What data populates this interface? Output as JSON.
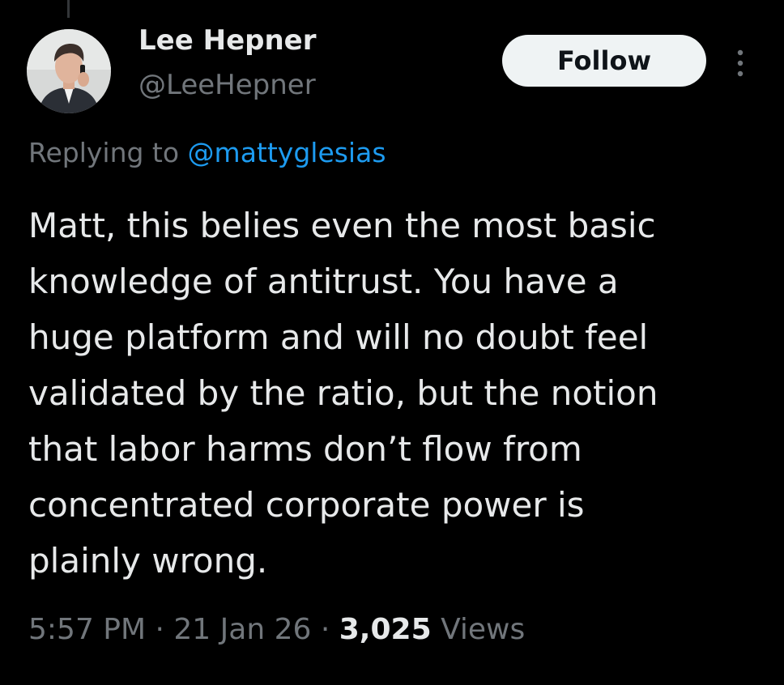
{
  "author": {
    "display_name": "Lee Hepner",
    "handle": "@LeeHepner"
  },
  "actions": {
    "follow_label": "Follow"
  },
  "reply_context": {
    "prefix": "Replying to ",
    "mention": "@mattyglesias"
  },
  "tweet": {
    "lines": [
      "Matt, this belies even the most basic",
      "knowledge of antitrust. You have a",
      "huge platform and will no doubt feel",
      "validated by the ratio, but the notion",
      "that labor harms don’t flow from",
      "concentrated corporate power is",
      "plainly wrong."
    ]
  },
  "meta": {
    "time": "5:57 PM",
    "sep1": " · ",
    "date": "21 Jan 26",
    "sep2": " · ",
    "views_count": "3,025",
    "views_label": " Views"
  },
  "icons": {
    "more": "more-vertical-icon",
    "avatar": "avatar-photo"
  },
  "colors": {
    "background": "#000000",
    "text_primary": "#e7e9ea",
    "text_secondary": "#71767b",
    "link": "#1d9bf0",
    "follow_bg": "#eff3f4",
    "follow_text": "#0f1419"
  }
}
